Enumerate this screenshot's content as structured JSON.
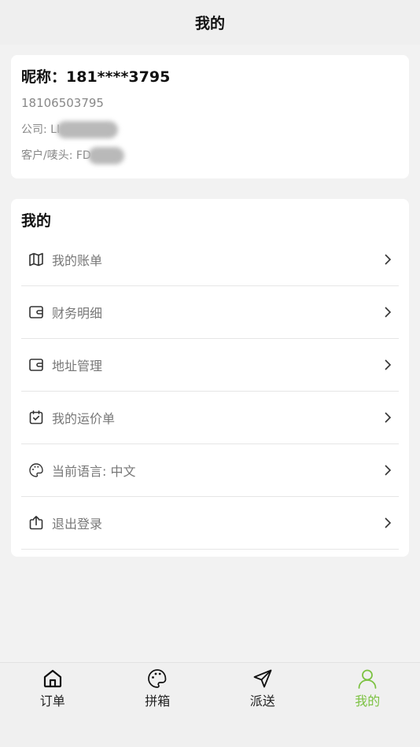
{
  "header": {
    "title": "我的"
  },
  "profile": {
    "nickname": "昵称：181****3795",
    "phone": "18106503795",
    "company_label": "公司: LI",
    "customer_label": "客户/唛头: FD"
  },
  "menu": {
    "title": "我的",
    "items": [
      {
        "label": "我的账单",
        "icon": "map-icon"
      },
      {
        "label": "财务明细",
        "icon": "wallet-icon"
      },
      {
        "label": "地址管理",
        "icon": "wallet-icon"
      },
      {
        "label": "我的运价单",
        "icon": "calendar-check-icon"
      },
      {
        "label": "当前语言: 中文",
        "icon": "palette-icon"
      },
      {
        "label": "退出登录",
        "icon": "share-out-icon"
      }
    ]
  },
  "tabbar": {
    "tabs": [
      {
        "label": "订单",
        "icon": "home-icon"
      },
      {
        "label": "拼箱",
        "icon": "palette-icon"
      },
      {
        "label": "派送",
        "icon": "send-icon"
      },
      {
        "label": "我的",
        "icon": "user-icon",
        "active": true
      }
    ],
    "active_color": "#7cc242"
  }
}
